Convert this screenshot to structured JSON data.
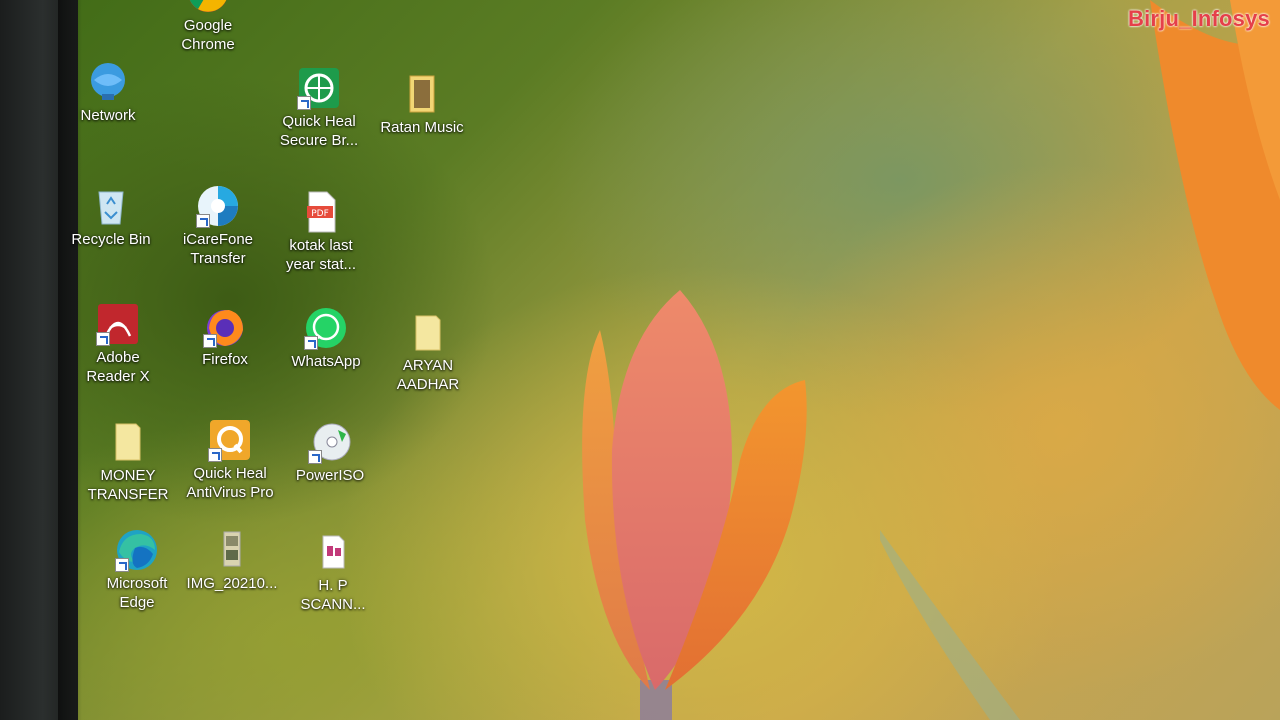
{
  "watermark": "Birju_Infosys",
  "desktop": {
    "icons": [
      {
        "id": "google-chrome",
        "label": "Google\nChrome",
        "icon": "chrome-icon"
      },
      {
        "id": "network",
        "label": "Network",
        "icon": "network-icon"
      },
      {
        "id": "quick-heal-secure-browser",
        "label": "Quick Heal\nSecure Br...",
        "icon": "quick-heal-browser-icon"
      },
      {
        "id": "ratan-music",
        "label": "Ratan Music",
        "icon": "folder-icon"
      },
      {
        "id": "recycle-bin",
        "label": "Recycle Bin",
        "icon": "recycle-bin-icon"
      },
      {
        "id": "icarefone-transfer",
        "label": "iCareFone\nTransfer",
        "icon": "icarefone-icon"
      },
      {
        "id": "kotak-last-year",
        "label": "kotak last\nyear stat...",
        "icon": "pdf-icon"
      },
      {
        "id": "adobe-reader",
        "label": "Adobe\nReader X",
        "icon": "adobe-reader-icon"
      },
      {
        "id": "firefox",
        "label": "Firefox",
        "icon": "firefox-icon"
      },
      {
        "id": "whatsapp",
        "label": "WhatsApp",
        "icon": "whatsapp-icon"
      },
      {
        "id": "aryan-aadhar",
        "label": "ARYAN\nAADHAR",
        "icon": "folder-icon"
      },
      {
        "id": "money-transfer",
        "label": "MONEY\nTRANSFER",
        "icon": "folder-icon"
      },
      {
        "id": "quick-heal-antivirus",
        "label": "Quick Heal\nAntiVirus Pro",
        "icon": "quick-heal-antivirus-icon"
      },
      {
        "id": "poweriso",
        "label": "PowerISO",
        "icon": "poweriso-icon"
      },
      {
        "id": "microsoft-edge",
        "label": "Microsoft\nEdge",
        "icon": "edge-icon"
      },
      {
        "id": "img-2021",
        "label": "IMG_20210...",
        "icon": "image-file-icon"
      },
      {
        "id": "hp-scann",
        "label": "H. P\nSCANN...",
        "icon": "document-icon"
      }
    ]
  }
}
